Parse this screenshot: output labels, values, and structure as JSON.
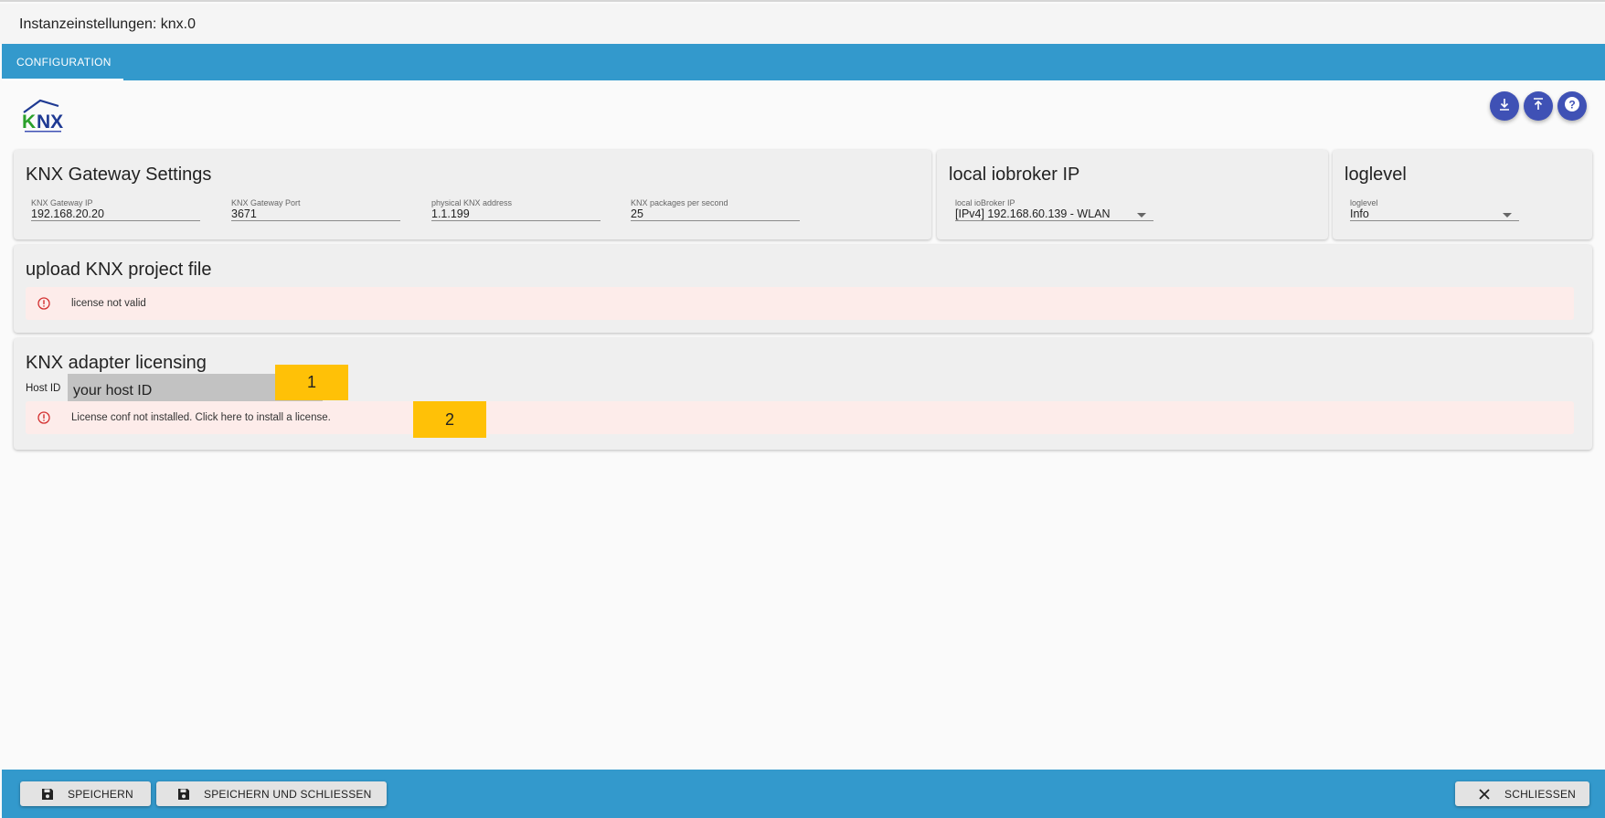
{
  "window": {
    "title": "Instanzeinstellungen: knx.0"
  },
  "tabs": [
    {
      "label": "CONFIGURATION"
    }
  ],
  "logo": {
    "alt": "KNX"
  },
  "colors": {
    "accent": "#3399cc",
    "fab": "#3f51b5",
    "alert_bg": "#fdecea",
    "alert_icon": "#d32f2f",
    "marker": "#ffc107"
  },
  "actions": [
    {
      "icon": "download-icon"
    },
    {
      "icon": "upload-icon"
    },
    {
      "icon": "help-icon"
    }
  ],
  "gateway": {
    "title": "KNX Gateway Settings",
    "fields": [
      {
        "label": "KNX Gateway IP",
        "value": "192.168.20.20"
      },
      {
        "label": "KNX Gateway Port",
        "value": "3671"
      },
      {
        "label": "physical KNX address",
        "value": "1.1.199"
      },
      {
        "label": "KNX packages per second",
        "value": "25"
      }
    ]
  },
  "local_ip": {
    "title": "local iobroker IP",
    "label": "local ioBroker IP",
    "value": "[IPv4] 192.168.60.139 - WLAN"
  },
  "loglevel": {
    "title": "loglevel",
    "label": "loglevel",
    "value": "Info"
  },
  "upload": {
    "title": "upload KNX project file",
    "alert": "license not valid"
  },
  "licensing": {
    "title": "KNX adapter licensing",
    "host_label": "Host ID",
    "host_value": "your host ID",
    "alert": "License conf not installed. Click here to install a license.",
    "marker1": "1",
    "marker2": "2"
  },
  "footer": {
    "save": "SPEICHERN",
    "save_close": "SPEICHERN UND SCHLIESSEN",
    "close": "SCHLIESSEN"
  }
}
